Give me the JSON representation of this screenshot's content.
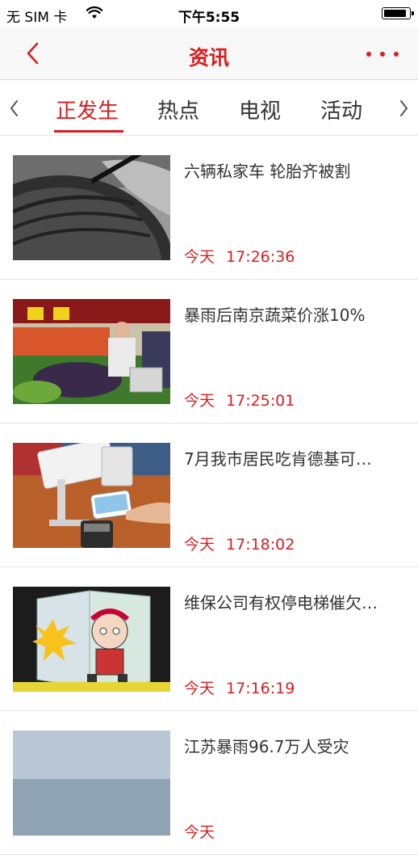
{
  "status_bar": {
    "carrier": "无 SIM 卡",
    "time": "下午5:55"
  },
  "navbar": {
    "title": "资讯",
    "back_icon": "chevron-left-icon",
    "more_icon": "more-dots-icon",
    "accent": "#d81e1e"
  },
  "tabs": {
    "items": [
      {
        "label": "正发生",
        "active": true
      },
      {
        "label": "热点",
        "active": false
      },
      {
        "label": "电视",
        "active": false
      },
      {
        "label": "活动",
        "active": false
      }
    ],
    "prev_icon": "chevron-left-icon",
    "next_icon": "chevron-right-icon"
  },
  "news": [
    {
      "title": "六辆私家车 轮胎齐被割",
      "day": "今天",
      "time": "17:26:36"
    },
    {
      "title": "暴雨后南京蔬菜价涨10%",
      "day": "今天",
      "time": "17:25:01"
    },
    {
      "title": "7月我市居民吃肯德基可…",
      "day": "今天",
      "time": "17:18:02"
    },
    {
      "title": "维保公司有权停电梯催欠…",
      "day": "今天",
      "time": "17:16:19"
    },
    {
      "title": "江苏暴雨96.7万人受灾",
      "day": "今天",
      "time": ""
    }
  ]
}
